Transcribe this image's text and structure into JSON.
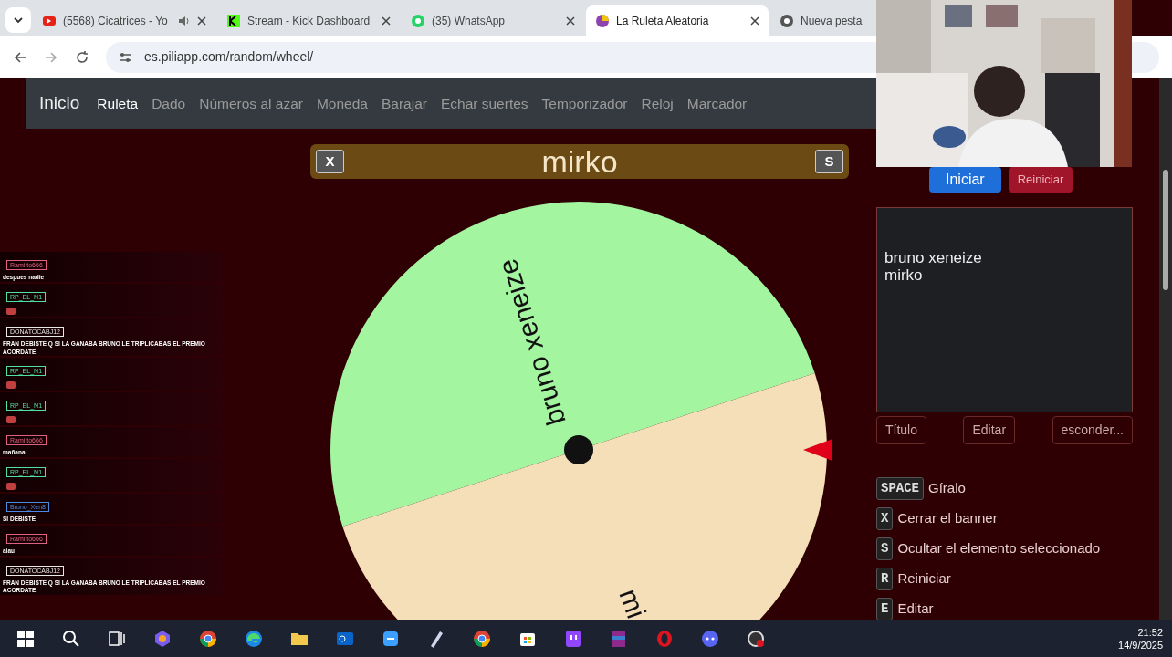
{
  "browser": {
    "tabs": [
      {
        "title": "(5568) Cicatrices - Yo",
        "kind": "video",
        "audio": true,
        "selected": false
      },
      {
        "title": "Stream - Kick Dashboard",
        "kind": "kick",
        "audio": false,
        "selected": false
      },
      {
        "title": "(35) WhatsApp",
        "kind": "chat",
        "audio": false,
        "selected": false
      },
      {
        "title": "La Ruleta Aleatoria",
        "kind": "wheel",
        "audio": false,
        "selected": true
      },
      {
        "title": "Nueva pesta",
        "kind": "browser",
        "audio": false,
        "selected": false
      }
    ],
    "address": "es.piliapp.com/random/wheel/"
  },
  "nav": {
    "brand": "Inicio",
    "items": [
      {
        "label": "Ruleta",
        "selected": true
      },
      {
        "label": "Dado",
        "selected": false
      },
      {
        "label": "Números al azar",
        "selected": false
      },
      {
        "label": "Moneda",
        "selected": false
      },
      {
        "label": "Barajar",
        "selected": false
      },
      {
        "label": "Echar suertes",
        "selected": false
      },
      {
        "label": "Temporizador",
        "selected": false
      },
      {
        "label": "Reloj",
        "selected": false
      },
      {
        "label": "Marcador",
        "selected": false
      }
    ]
  },
  "banner": {
    "close_key": "X",
    "winner": "mirko",
    "hide_key": "S"
  },
  "wheel": {
    "slices": [
      {
        "label": "bruno xeneize",
        "color": "#a4f5a0"
      },
      {
        "label": "mi",
        "color": "#f5dfb8"
      }
    ]
  },
  "controls": {
    "start": "Iniciar",
    "reset": "Reiniciar",
    "entries": "bruno xeneize\nmirko",
    "buttons": [
      "Título",
      "Editar",
      "esconder..."
    ],
    "shortcuts": [
      {
        "key": "SPACE",
        "action": "Gíralo"
      },
      {
        "key": "X",
        "action": "Cerrar el banner"
      },
      {
        "key": "S",
        "action": "Ocultar el elemento seleccionado"
      },
      {
        "key": "R",
        "action": "Reiniciar"
      },
      {
        "key": "E",
        "action": "Editar"
      }
    ]
  },
  "chat": [
    {
      "user": "Rami to666",
      "color": "#e06080",
      "kind": "text",
      "text": "despues nadie"
    },
    {
      "user": "RP_EL_N1",
      "color": "#50e0a0",
      "kind": "emote"
    },
    {
      "user": "DONATOCABJ12",
      "color": "#e8e8e8",
      "kind": "text",
      "text": "FRAN DEBISTE Q SI LA GANABA BRUNO LE TRIPLICABAS EL PREMIO ACORDATE"
    },
    {
      "user": "RP_EL_N1",
      "color": "#50e0a0",
      "kind": "emote"
    },
    {
      "user": "RP_EL_N1",
      "color": "#50e0a0",
      "kind": "emote"
    },
    {
      "user": "Rami to666",
      "color": "#e06080",
      "kind": "text",
      "text": "mañana"
    },
    {
      "user": "RP_EL_N1",
      "color": "#50e0a0",
      "kind": "emote"
    },
    {
      "user": "Bruno_Xen8",
      "color": "#4a8ae0",
      "kind": "text",
      "text": "SI DEBISTE"
    },
    {
      "user": "Rami to666",
      "color": "#e06080",
      "kind": "text",
      "text": "aiau"
    },
    {
      "user": "DONATOCABJ12",
      "color": "#e8e8e8",
      "kind": "text",
      "text": "FRAN DEBISTE Q SI LA GANABA BRUNO LE TRIPLICABAS EL PREMIO ACORDATE"
    }
  ],
  "taskbar": {
    "time": "21:52",
    "date": "14/9/2025"
  }
}
